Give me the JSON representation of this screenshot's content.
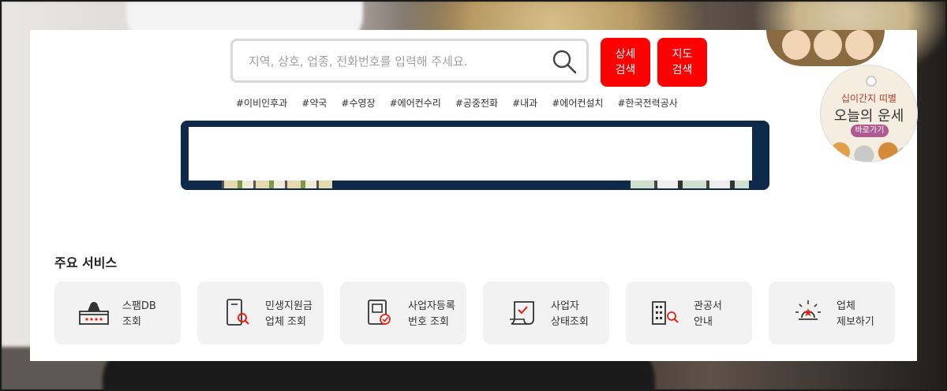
{
  "search": {
    "placeholder": "지역, 상호, 업종, 전화번호를 입력해 주세요.",
    "detail_btn": [
      "상세",
      "검색"
    ],
    "map_btn": [
      "지도",
      "검색"
    ]
  },
  "tags": [
    "#이비인후과",
    "#약국",
    "#수영장",
    "#에어컨수리",
    "#공중전화",
    "#내과",
    "#에어컨설치",
    "#한국전력공사"
  ],
  "fortune": {
    "line1": "십이간지 띠별",
    "line2": "오늘의 운세",
    "go": "바로가기"
  },
  "services": {
    "title": "주요 서비스",
    "items": [
      {
        "icon": "spam-db-icon",
        "lines": [
          "스팸DB",
          "조회"
        ]
      },
      {
        "icon": "search-document-icon",
        "lines": [
          "민생지원금",
          "업체 조회"
        ]
      },
      {
        "icon": "business-check-icon",
        "lines": [
          "사업자등록",
          "번호 조회"
        ]
      },
      {
        "icon": "status-scroll-icon",
        "lines": [
          "사업자",
          "상태조회"
        ]
      },
      {
        "icon": "government-building-icon",
        "lines": [
          "관공서",
          "안내"
        ]
      },
      {
        "icon": "report-light-icon",
        "lines": [
          "업체",
          "제보하기"
        ]
      }
    ]
  },
  "colors": {
    "accent": "#ff0000",
    "banner": "#0e2a4a",
    "tile": "#f2f2f2"
  }
}
